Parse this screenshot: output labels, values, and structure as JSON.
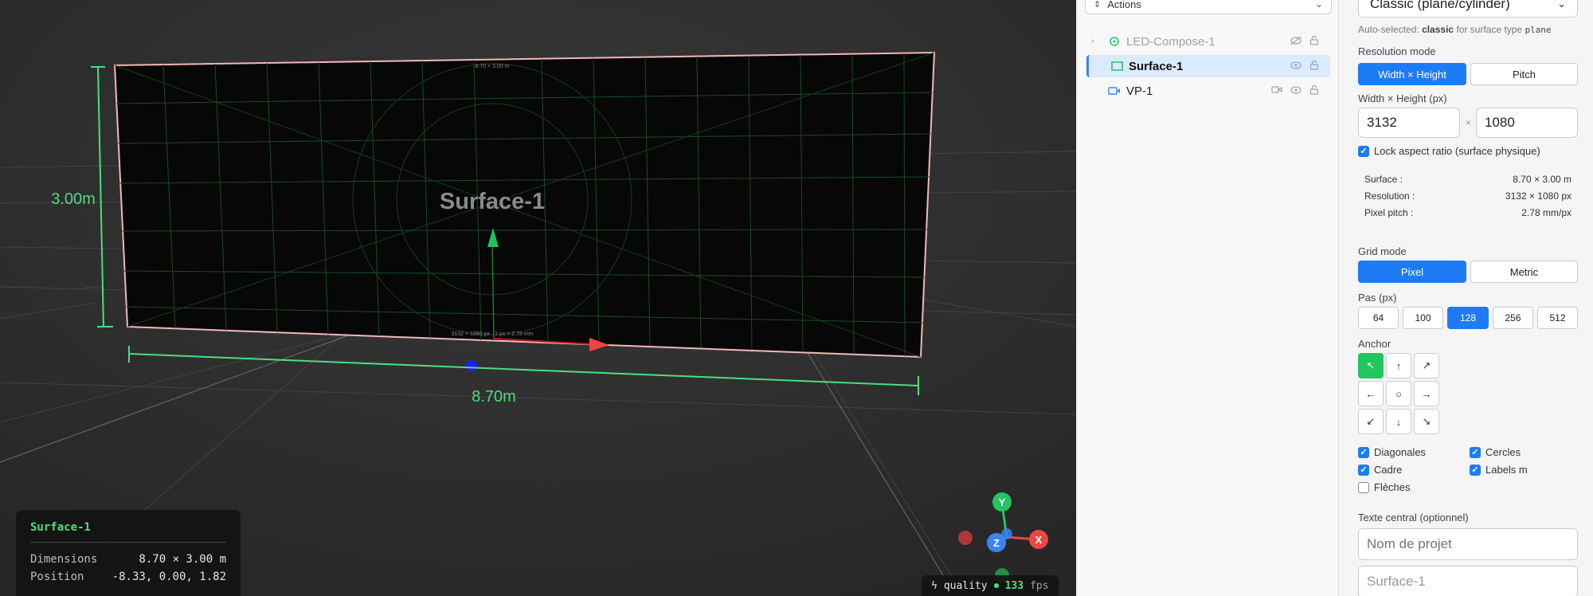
{
  "viewport": {
    "surface_name": "Surface-1",
    "surface_top_label": "8.70 × 3.00 m",
    "surface_bottom_label": "3132 × 1080 px · 1 px = 2.78 mm",
    "height_dim": "3.00m",
    "width_dim": "8.70m",
    "info_panel": {
      "title": "Surface-1",
      "rows": [
        {
          "key": "Dimensions",
          "value": "8.70 × 3.00 m"
        },
        {
          "key": "Position",
          "value": "-8.33, 0.00, 1.82"
        }
      ]
    },
    "quality_label": "quality",
    "fps_value": "133",
    "fps_unit": "fps",
    "gizmo": {
      "y": "Y",
      "x": "X",
      "z": "Z"
    }
  },
  "outliner": {
    "actions_label": "Actions",
    "items": [
      {
        "label": "LED-Compose-1"
      },
      {
        "label": "Surface-1"
      },
      {
        "label": "VP-1"
      }
    ]
  },
  "props": {
    "mode_select": "Classic (plane/cylinder)",
    "auto_selected_prefix": "Auto-selected:",
    "auto_selected_value": "classic",
    "auto_selected_mid": "for surface type",
    "auto_selected_type": "plane",
    "resolution_mode_label": "Resolution mode",
    "resolution_modes": [
      "Width × Height",
      "Pitch"
    ],
    "wh_label": "Width × Height (px)",
    "width_value": "3132",
    "times": "×",
    "height_value": "1080",
    "lock_aspect_label": "Lock aspect ratio (surface physique)",
    "summary": [
      {
        "k": "Surface :",
        "v": "8.70 × 3.00 m"
      },
      {
        "k": "Resolution :",
        "v": "3132 × 1080 px"
      },
      {
        "k": "Pixel pitch :",
        "v": "2.78 mm/px"
      }
    ],
    "grid_mode_label": "Grid mode",
    "grid_modes": [
      "Pixel",
      "Metric"
    ],
    "pas_label": "Pas (px)",
    "steps": [
      "64",
      "100",
      "128",
      "256",
      "512"
    ],
    "anchor_label": "Anchor",
    "options": {
      "diagonales": "Diagonales",
      "cercles": "Cercles",
      "cadre": "Cadre",
      "labels_m": "Labels m",
      "fleches": "Flèches"
    },
    "texte_central_label": "Texte central (optionnel)",
    "project_placeholder": "Nom de projet",
    "surface_text_value": "Surface-1"
  }
}
